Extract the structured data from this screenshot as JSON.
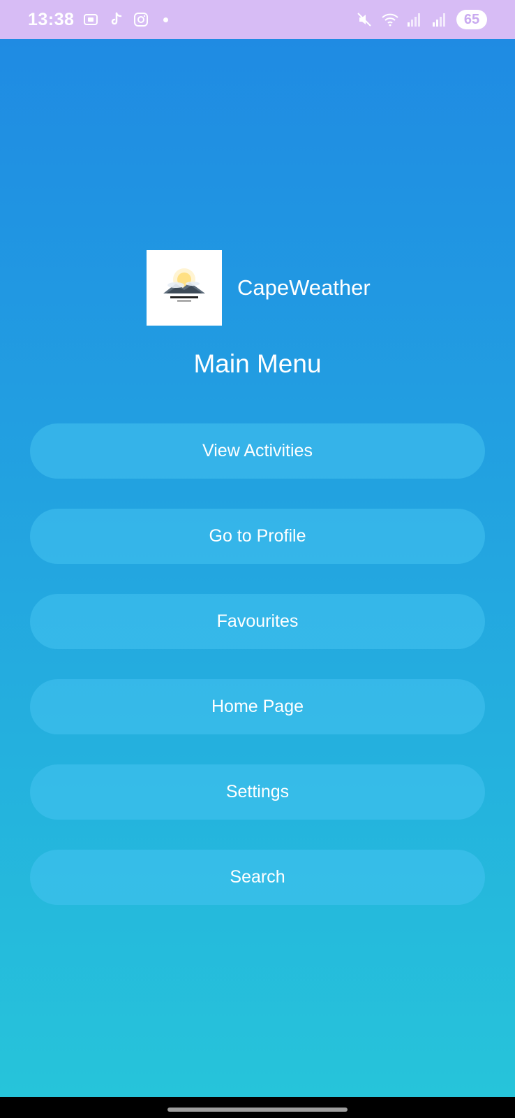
{
  "status_bar": {
    "time": "13:38",
    "icons_left": [
      "screenshot-icon",
      "tiktok-icon",
      "instagram-icon",
      "notification-dot"
    ],
    "icons_right": [
      "mute-icon",
      "wifi-icon",
      "signal-icon",
      "signal-icon"
    ],
    "battery": "65",
    "bg_color": "#d7bcf5"
  },
  "header": {
    "app_name": "CapeWeather",
    "logo_text": "CAPEWEATHER"
  },
  "main": {
    "title": "Main Menu",
    "gradient": [
      "#1f8be3",
      "#26c4da"
    ],
    "buttons": [
      {
        "label": "View Activities"
      },
      {
        "label": "Go to Profile"
      },
      {
        "label": "Favourites"
      },
      {
        "label": "Home Page"
      },
      {
        "label": "Settings"
      },
      {
        "label": "Search"
      }
    ]
  }
}
